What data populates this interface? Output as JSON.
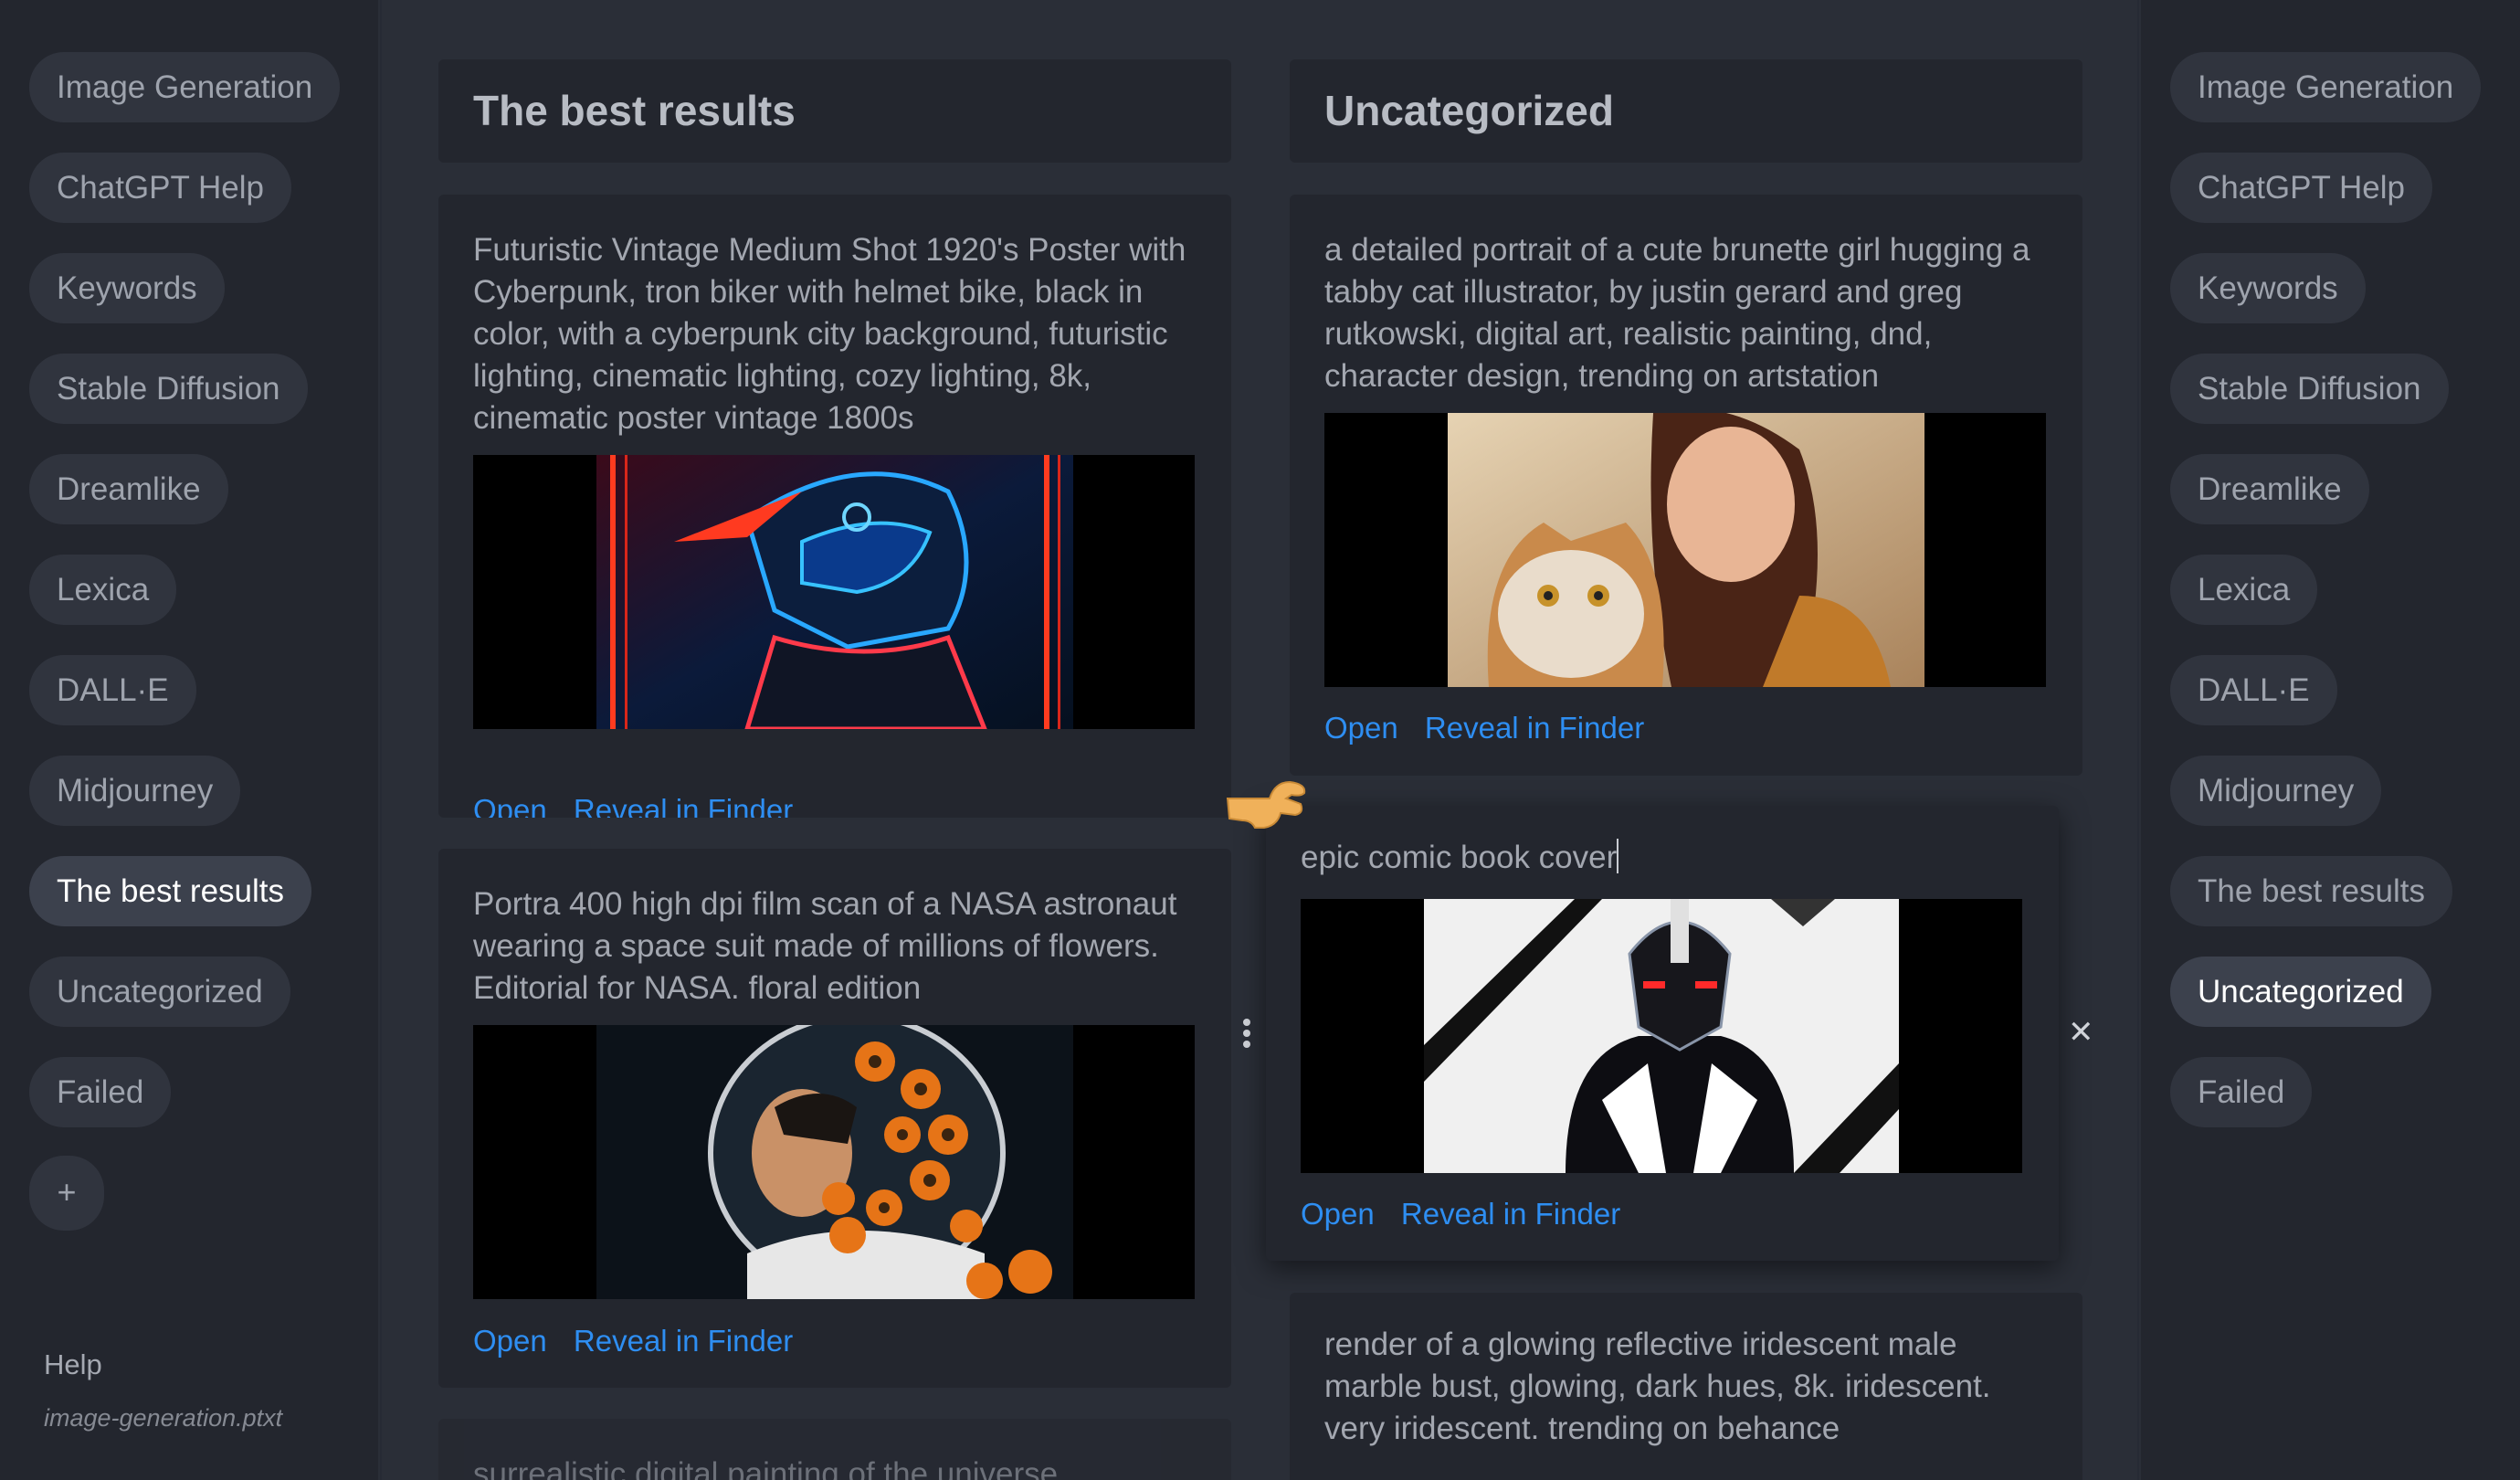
{
  "left_sidebar": {
    "items": [
      {
        "label": "Image Generation",
        "active": false
      },
      {
        "label": "ChatGPT Help",
        "active": false
      },
      {
        "label": "Keywords",
        "active": false
      },
      {
        "label": "Stable Diffusion",
        "active": false
      },
      {
        "label": "Dreamlike",
        "active": false
      },
      {
        "label": "Lexica",
        "active": false
      },
      {
        "label": "DALL·E",
        "active": false
      },
      {
        "label": "Midjourney",
        "active": false
      },
      {
        "label": "The best results",
        "active": true
      },
      {
        "label": "Uncategorized",
        "active": false
      },
      {
        "label": "Failed",
        "active": false
      }
    ],
    "add_label": "+",
    "help_label": "Help",
    "filename": "image-generation.ptxt"
  },
  "right_sidebar": {
    "items": [
      {
        "label": "Image Generation",
        "active": false
      },
      {
        "label": "ChatGPT Help",
        "active": false
      },
      {
        "label": "Keywords",
        "active": false
      },
      {
        "label": "Stable Diffusion",
        "active": false
      },
      {
        "label": "Dreamlike",
        "active": false
      },
      {
        "label": "Lexica",
        "active": false
      },
      {
        "label": "DALL·E",
        "active": false
      },
      {
        "label": "Midjourney",
        "active": false
      },
      {
        "label": "The best results",
        "active": false
      },
      {
        "label": "Uncategorized",
        "active": true
      },
      {
        "label": "Failed",
        "active": false
      }
    ]
  },
  "columns": [
    {
      "title": "The best results",
      "cards": [
        {
          "prompt": "Futuristic Vintage Medium Shot 1920's Poster with Cyberpunk, tron biker with helmet bike, black in color, with a cyberpunk city background, futuristic lighting, cinematic lighting, cozy lighting, 8k, cinematic poster vintage 1800s",
          "image": "cyberpunk-biker-image",
          "open_label": "Open",
          "reveal_label": "Reveal in Finder"
        },
        {
          "prompt": "Portra 400 high dpi film scan of a NASA astronaut wearing a space suit made of millions of flowers. Editorial for NASA. floral edition",
          "image": "floral-astronaut-image",
          "open_label": "Open",
          "reveal_label": "Reveal in Finder"
        },
        {
          "prompt": "surrealistic digital painting of the universe"
        }
      ]
    },
    {
      "title": "Uncategorized",
      "cards": [
        {
          "prompt": "a detailed portrait of a cute brunette girl hugging a tabby cat illustrator, by justin gerard and greg rutkowski, digital art, realistic painting, dnd, character design, trending on artstation",
          "image": "girl-with-cat-image",
          "open_label": "Open",
          "reveal_label": "Reveal in Finder"
        },
        {
          "prompt": "epic comic book cover",
          "image": "comic-hero-image",
          "open_label": "Open",
          "reveal_label": "Reveal in Finder"
        },
        {
          "prompt": "render of a glowing reflective iridescent male marble bust, glowing, dark hues, 8k. iridescent. very iridescent. trending on behance"
        }
      ]
    }
  ],
  "icons": {
    "close": "close-icon",
    "drag": "drag-handle-icon",
    "cursor": "grab-hand-cursor-icon"
  },
  "colors": {
    "link": "#2e8ef2",
    "active_pill": "#3c414d",
    "cursor_hand": "#f0b15a"
  }
}
